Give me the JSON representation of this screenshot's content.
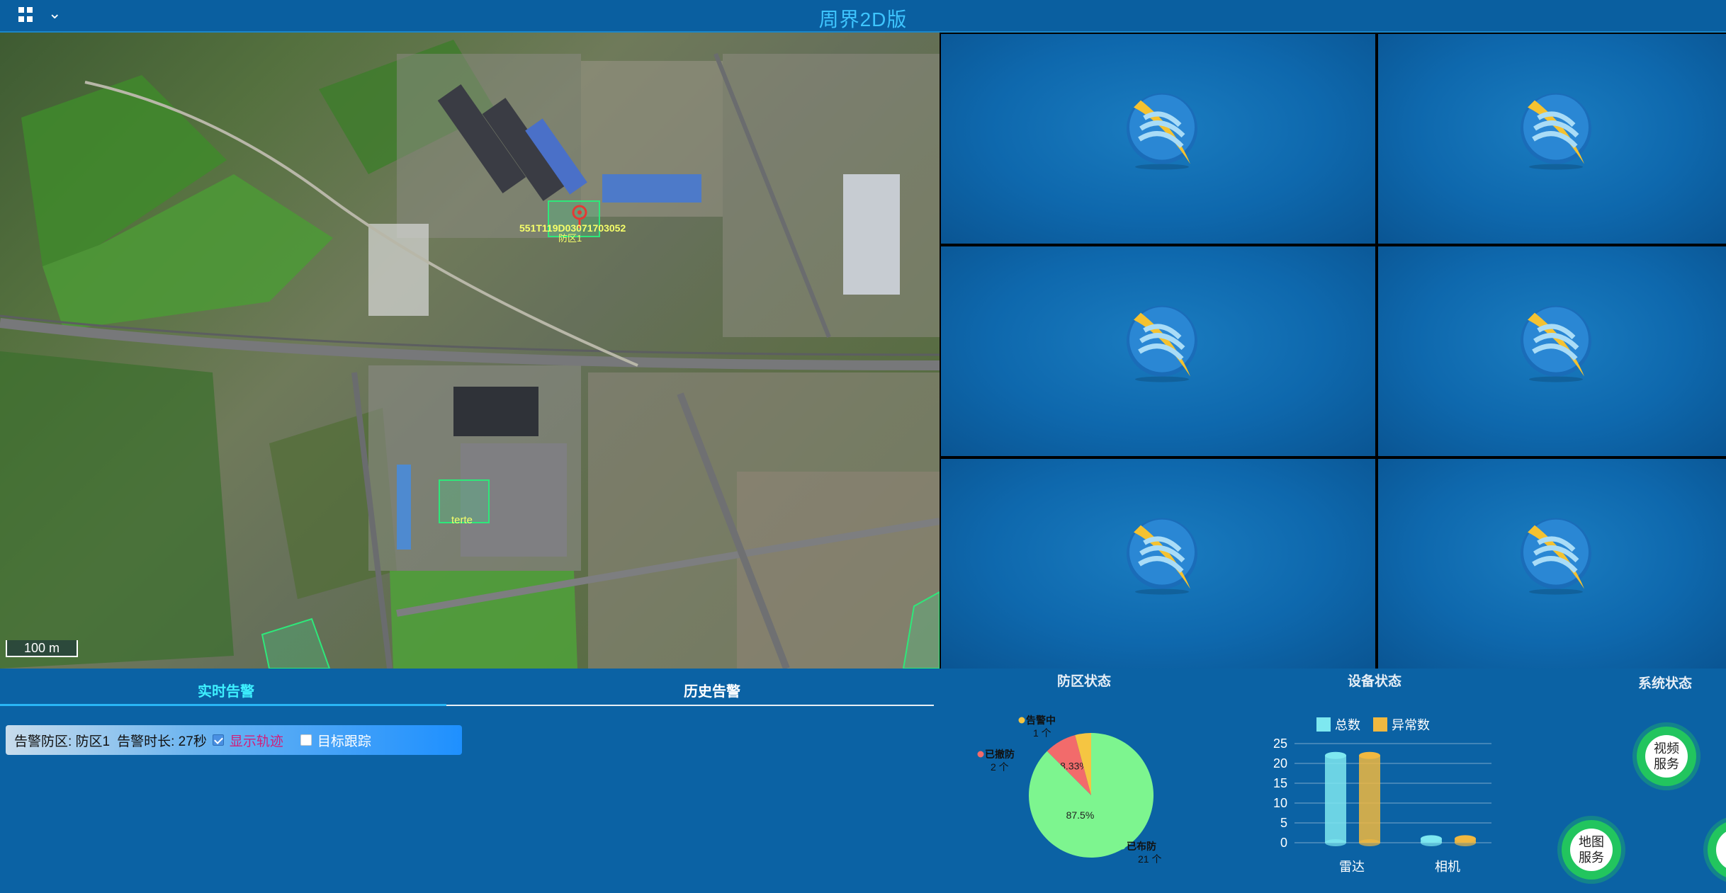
{
  "header": {
    "title": "周界2D版"
  },
  "map": {
    "zone1_label": "防区1",
    "zone1_device": "551T119D03071703052",
    "zone2_label": "terte",
    "scale": "100 m"
  },
  "videos": [
    "",
    "",
    "",
    "",
    "",
    ""
  ],
  "alarm": {
    "tabs": [
      "实时告警",
      "历史告警"
    ],
    "row": {
      "zone": "告警防区: 防区1",
      "duration": "告警时长: 27秒",
      "show_track": "显示轨迹",
      "target_track": "目标跟踪"
    }
  },
  "status": {
    "zone_title": "防区状态",
    "device_title": "设备状态",
    "system_title": "系统状态"
  },
  "chart_data": [
    {
      "type": "pie",
      "title": "防区状态",
      "slices": [
        {
          "name": "已布防",
          "count": "21 个",
          "value": 87.5,
          "percent_label": "87.5%",
          "color": "#7df58f"
        },
        {
          "name": "已撤防",
          "count": "2 个",
          "value": 8.33,
          "percent_label": "8.33%",
          "color": "#f26b6b"
        },
        {
          "name": "告警中",
          "count": "1 个",
          "value": 4.17,
          "percent_label": "",
          "color": "#f5c542"
        }
      ]
    },
    {
      "type": "bar",
      "title": "设备状态",
      "categories": [
        "雷达",
        "相机"
      ],
      "series": [
        {
          "name": "总数",
          "values": [
            22,
            1
          ],
          "color": "#7ee8f0"
        },
        {
          "name": "异常数",
          "values": [
            22,
            1
          ],
          "color": "#f0b840"
        }
      ],
      "yticks": [
        "25",
        "20",
        "15",
        "10",
        "5",
        "0"
      ],
      "ylim": [
        0,
        25
      ]
    }
  ],
  "system": {
    "buttons": [
      "视频\n服务",
      "地图\n服务"
    ]
  }
}
